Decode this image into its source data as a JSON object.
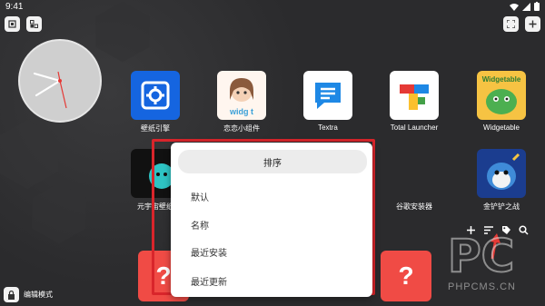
{
  "status": {
    "time": "9:41"
  },
  "apps": [
    {
      "label": "壁纸引擎",
      "icon": "wallpaper-engine-icon"
    },
    {
      "label": "恋恋小组件",
      "icon": "widget-girl-icon"
    },
    {
      "label": "Textra",
      "icon": "textra-icon"
    },
    {
      "label": "Total Launcher",
      "icon": "total-launcher-icon"
    },
    {
      "label": "Widgetable",
      "icon": "widgetable-icon"
    },
    {
      "label": "元宇宙壁纸",
      "icon": "metaverse-wallpaper-icon"
    },
    {
      "label": "谷歌安装器",
      "icon": "google-installer-icon"
    },
    {
      "label": "金铲铲之战",
      "icon": "golden-spatula-icon"
    }
  ],
  "widget_icon_text": "widg t",
  "widgetable_icon_text": "Widgetable",
  "sort_menu": {
    "title": "排序",
    "items": [
      "默认",
      "名称",
      "最近安装",
      "最近更新"
    ]
  },
  "placeholder_icon": "?",
  "edit_mode_label": "编辑模式",
  "watermark": {
    "logo": "PC",
    "site": "PHPCMS.CN"
  },
  "colors": {
    "accent_red": "#d9252b",
    "placeholder_red": "#f04b45",
    "background": "#2b2b2d"
  }
}
